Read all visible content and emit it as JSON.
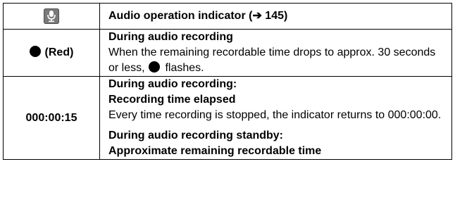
{
  "table": {
    "rows": [
      {
        "indicator_icon": "microphone-icon",
        "description_title": "Audio operation indicator (➔ 145)"
      },
      {
        "indicator_label": "(Red)",
        "indicator_icon": "black-dot-icon",
        "heading": "During audio recording",
        "text_before_dot": "When the remaining recordable time drops to approx. 30 seconds or less,",
        "text_after_dot": "flashes."
      },
      {
        "indicator_label": "000:00:15",
        "block1_heading_line1": "During audio recording:",
        "block1_heading_line2": "Recording time elapsed",
        "block1_text": "Every time recording is stopped, the indicator returns to 000:00:00.",
        "block2_heading_line1": "During audio recording standby:",
        "block2_heading_line2": "Approximate remaining recordable time"
      }
    ]
  },
  "colors": {
    "border": "#000000",
    "icon_bg": "#7a7a7a",
    "dot": "#000000"
  }
}
